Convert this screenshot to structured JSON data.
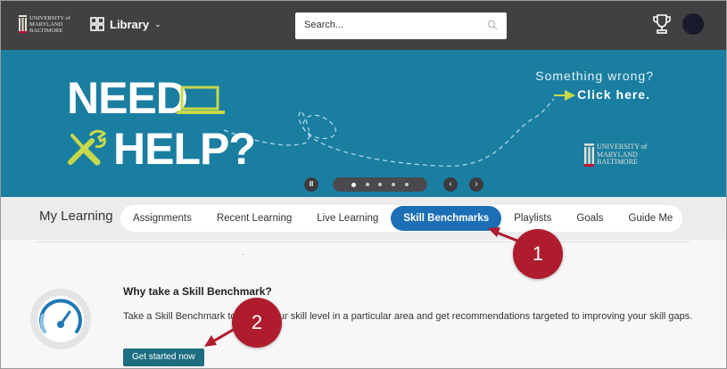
{
  "header": {
    "logo_text": "UNIVERSITY of MARYLAND BALTIMORE",
    "library_label": "Library",
    "search_placeholder": "Search...",
    "icons": [
      "grid-icon",
      "chevron-down-icon",
      "search-icon",
      "trophy-icon"
    ]
  },
  "banner": {
    "need_text": "NEED",
    "help_text": "HELP?",
    "wrong_text": "Something wrong?",
    "click_text": "Click here.",
    "logo_text": "UNIVERSITY of MARYLAND BALTIMORE",
    "carousel_count": 5,
    "carousel_active": 1
  },
  "learning": {
    "title": "My Learning",
    "tabs": [
      "Assignments",
      "Recent Learning",
      "Live Learning",
      "Skill Benchmarks",
      "Playlists",
      "Goals",
      "Guide Me"
    ],
    "active_tab": "Skill Benchmarks"
  },
  "content": {
    "heading": "Why take a Skill Benchmark?",
    "description": "Take a Skill Benchmark to gauge your skill level in a particular area and get recommendations targeted to improving your skill gaps.",
    "button_label": "Get started now"
  },
  "callouts": {
    "first": "1",
    "second": "2"
  },
  "colors": {
    "topbar": "#414143",
    "banner": "#1a7ea1",
    "accent": "#1c6fb5",
    "button": "#1c6e80",
    "callout": "#ae1c2e"
  }
}
